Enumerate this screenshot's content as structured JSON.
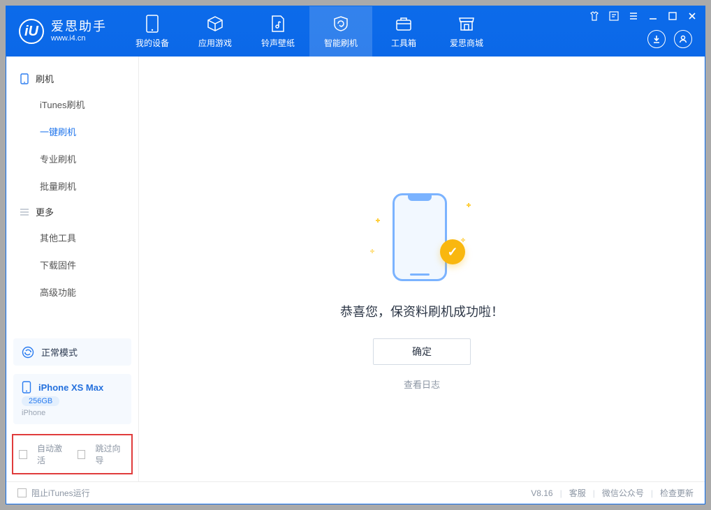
{
  "app": {
    "name": "爱思助手",
    "url": "www.i4.cn"
  },
  "nav": {
    "my_device": "我的设备",
    "apps_games": "应用游戏",
    "ringtones": "铃声壁纸",
    "smart_flash": "智能刷机",
    "toolbox": "工具箱",
    "store": "爱思商城"
  },
  "sidebar": {
    "group_flash": "刷机",
    "items_flash": [
      "iTunes刷机",
      "一键刷机",
      "专业刷机",
      "批量刷机"
    ],
    "group_more": "更多",
    "items_more": [
      "其他工具",
      "下载固件",
      "高级功能"
    ]
  },
  "mode": {
    "label": "正常模式"
  },
  "device": {
    "name": "iPhone XS Max",
    "capacity": "256GB",
    "type": "iPhone"
  },
  "checkboxes": {
    "auto_activate": "自动激活",
    "skip_guide": "跳过向导"
  },
  "main": {
    "success": "恭喜您，保资料刷机成功啦！",
    "ok": "确定",
    "view_log": "查看日志"
  },
  "status": {
    "block_itunes": "阻止iTunes运行",
    "version": "V8.16",
    "customer_service": "客服",
    "wechat": "微信公众号",
    "check_update": "检查更新"
  }
}
